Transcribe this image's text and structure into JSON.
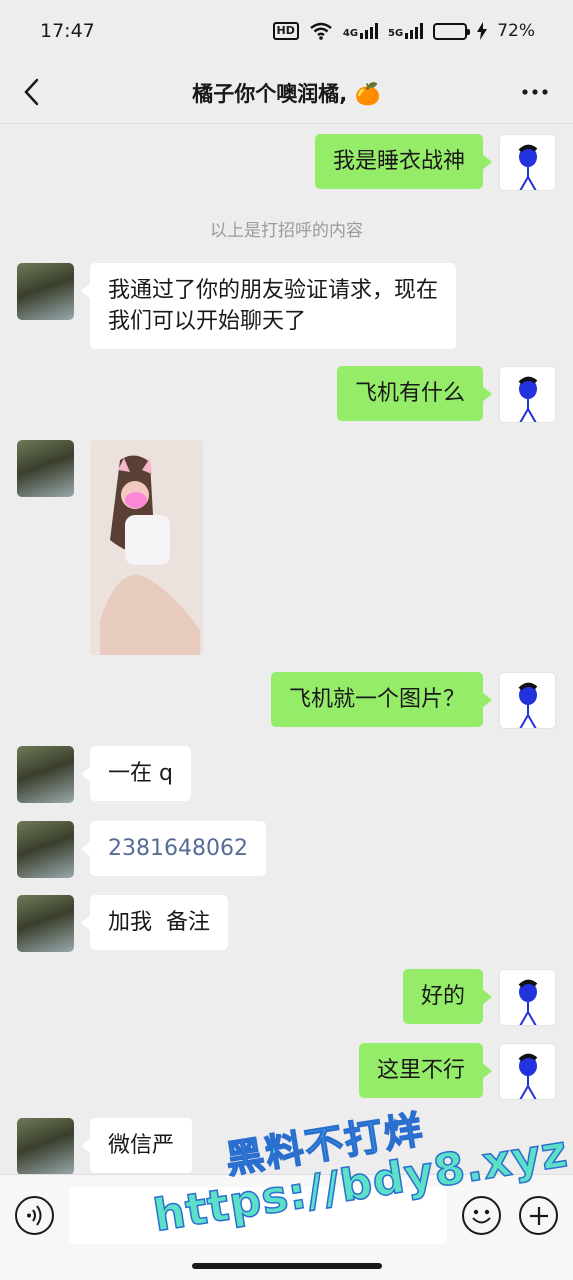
{
  "status_bar": {
    "time": "17:47",
    "hd_label": "HD",
    "network_1": "4G",
    "network_2": "5G",
    "battery": "72%",
    "battery_level": 0.72
  },
  "header": {
    "title": "橘子你个噢润橘, 🍊",
    "back_icon": "chevron-left-icon",
    "more_icon": "more-dots-icon"
  },
  "chat": {
    "system_tip": "以上是打招呼的内容",
    "messages": [
      {
        "sender": "me",
        "type": "text",
        "text": "我是睡衣战神"
      },
      {
        "sender": "her",
        "type": "text",
        "lines": [
          "我通过了你的朋友验证请求，现在",
          "我们可以开始聊天了"
        ]
      },
      {
        "sender": "me",
        "type": "text",
        "text": "飞机有什么"
      },
      {
        "sender": "her",
        "type": "image",
        "icon": "photo-image"
      },
      {
        "sender": "me",
        "type": "text",
        "text": "飞机就一个图片？"
      },
      {
        "sender": "her",
        "type": "text",
        "text": "一在 q"
      },
      {
        "sender": "her",
        "type": "text",
        "text": "2381648062"
      },
      {
        "sender": "her",
        "type": "text",
        "text": "加我  备注"
      },
      {
        "sender": "me",
        "type": "text",
        "text": "好的"
      },
      {
        "sender": "me",
        "type": "text",
        "text": "这里不行"
      },
      {
        "sender": "her",
        "type": "text",
        "text": "微信严"
      }
    ]
  },
  "input_bar": {
    "voice_icon": "voice-icon",
    "input_value": "",
    "emoji_icon": "emoji-icon",
    "plus_icon": "plus-icon"
  },
  "watermark": {
    "line1": "黑料不打烊",
    "line2": "https://bdy8.xyz"
  },
  "colors": {
    "background": "#ededed",
    "bubble_out": "#95ec69",
    "bubble_in": "#ffffff",
    "link": "#576b95",
    "tip": "#9b9b9b",
    "watermark_fill": "#5ce0c8",
    "watermark_stroke": "#2a6fd0"
  }
}
